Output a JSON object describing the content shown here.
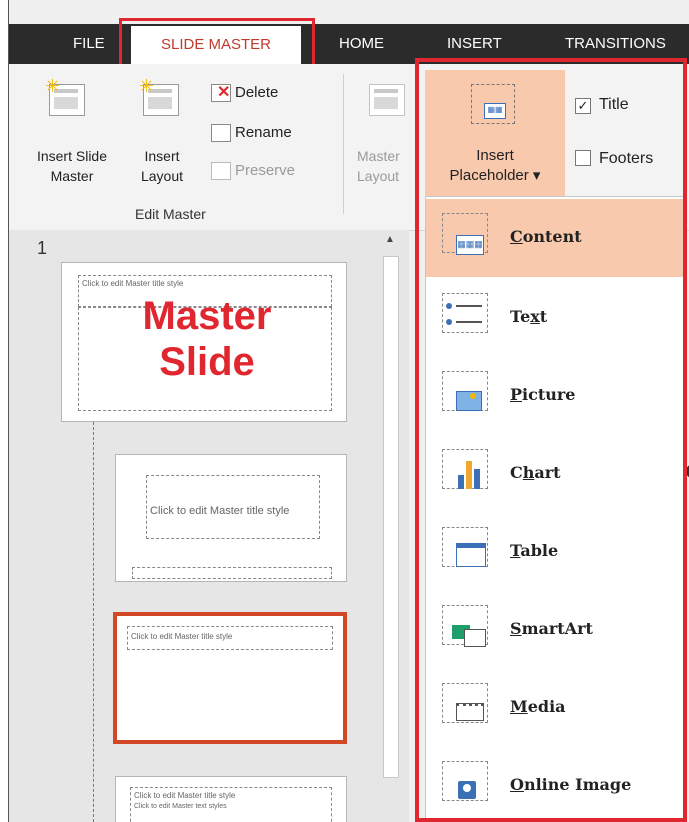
{
  "tabs": [
    {
      "label": "FILE"
    },
    {
      "label": "SLIDE MASTER"
    },
    {
      "label": "HOME"
    },
    {
      "label": "INSERT"
    },
    {
      "label": "TRANSITIONS"
    }
  ],
  "edit_master": {
    "insert_slide_master": "Insert Slide\nMaster",
    "insert_layout": "Insert\nLayout",
    "delete": "Delete",
    "rename": "Rename",
    "preserve": "Preserve",
    "group_label": "Edit Master"
  },
  "master_layout": {
    "label": "Master\nLayout"
  },
  "insert_placeholder": {
    "label": "Insert\nPlaceholder ▾"
  },
  "checkboxes": [
    {
      "label": "Title",
      "checked": true
    },
    {
      "label": "Footers",
      "checked": false
    }
  ],
  "slide_number": "1",
  "annotation": "Master\nSlide",
  "thumbnails": {
    "master_title": "Click to edit Master title style",
    "layout_title": "Click to edit Master title style",
    "small_title": "Click to edit Master title style",
    "small_sub": "Click to edit Master text styles"
  },
  "menu": [
    {
      "label": "Content",
      "accel": "C",
      "icon": "content-icon"
    },
    {
      "label": "Text",
      "accel": "x",
      "icon": "text-icon"
    },
    {
      "label": "Picture",
      "accel": "P",
      "icon": "picture-icon"
    },
    {
      "label": "Chart",
      "accel": "h",
      "icon": "chart-icon"
    },
    {
      "label": "Table",
      "accel": "T",
      "icon": "table-icon"
    },
    {
      "label": "SmartArt",
      "accel": "S",
      "icon": "smartart-icon"
    },
    {
      "label": "Media",
      "accel": "M",
      "icon": "media-icon"
    },
    {
      "label": "Online Image",
      "accel": "O",
      "icon": "online-image-icon"
    }
  ],
  "colors": {
    "accent": "#e0262f",
    "highlight": "#f9c9ad",
    "tabbar": "#2b2b2b"
  }
}
